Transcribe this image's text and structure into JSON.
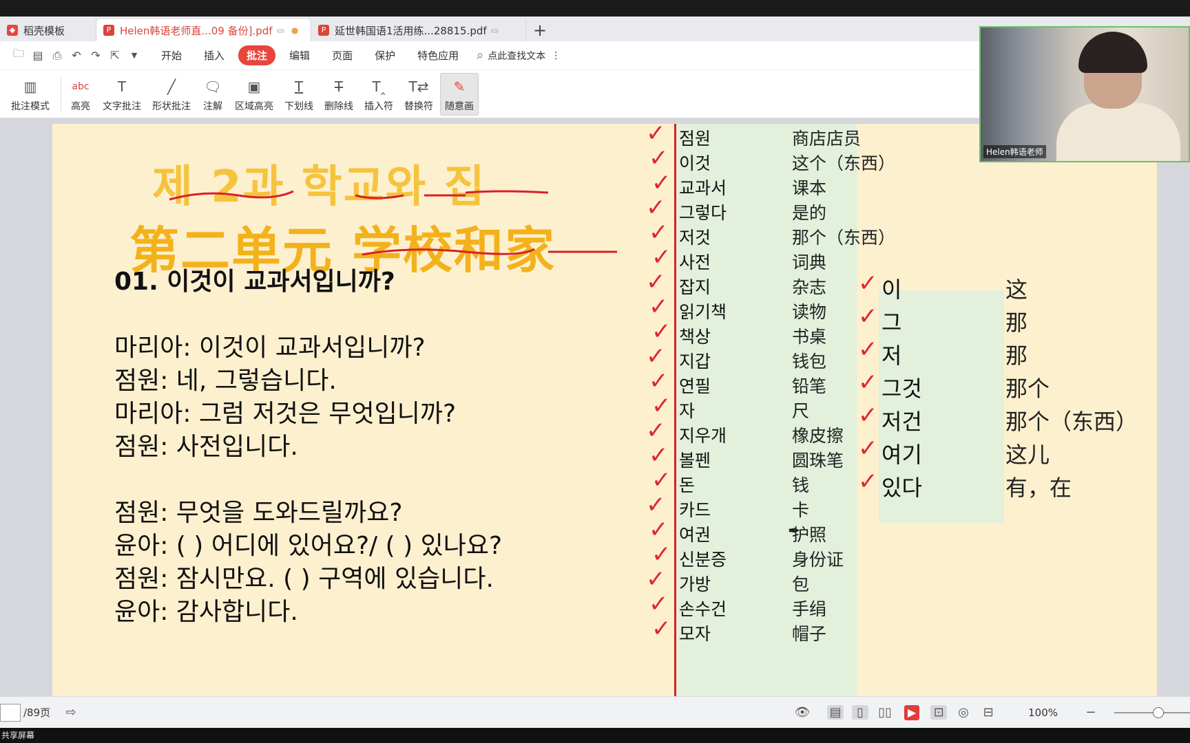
{
  "tabs": [
    {
      "label": "稻壳模板",
      "color": "#e8453c",
      "active": false
    },
    {
      "label": "Helen韩语老师直...09 备份].pdf",
      "color": "#d9453b",
      "active": true
    },
    {
      "label": "延世韩国语1活用练...28815.pdf",
      "color": "#d9453b",
      "active": false
    }
  ],
  "menu": [
    "开始",
    "插入",
    "批注",
    "编辑",
    "页面",
    "保护",
    "特色应用"
  ],
  "menu_active": "批注",
  "search_label": "点此查找文本",
  "ribbon": [
    {
      "label": "批注模式",
      "icon": "annotation-mode-icon"
    },
    {
      "label": "高亮",
      "icon": "highlight-icon"
    },
    {
      "label": "文字批注",
      "icon": "text-annotation-icon"
    },
    {
      "label": "形状批注",
      "icon": "shape-annotation-icon"
    },
    {
      "label": "注解",
      "icon": "note-icon"
    },
    {
      "label": "区域高亮",
      "icon": "area-highlight-icon"
    },
    {
      "label": "下划线",
      "icon": "underline-icon"
    },
    {
      "label": "删除线",
      "icon": "strikethrough-icon"
    },
    {
      "label": "插入符",
      "icon": "insert-caret-icon"
    },
    {
      "label": "替换符",
      "icon": "replace-caret-icon"
    },
    {
      "label": "随意画",
      "icon": "freehand-icon"
    }
  ],
  "document": {
    "title_kr": "제 2과  학교와 집",
    "title_cn": "第二单元  学校和家",
    "lesson": "01. 이것이 교과서입니까?",
    "dialog1": [
      "마리아: 이것이 교과서입니까?",
      "점원: 네, 그렇습니다.",
      "마리아: 그럼 저것은 무엇입니까?",
      "점원: 사전입니다."
    ],
    "dialog2": [
      "점원: 무엇을 도와드릴까요?",
      "윤아: (      ) 어디에 있어요?/ (      ) 있나요?",
      "점원: 잠시만요. (      ) 구역에 있습니다.",
      "윤아:  감사합니다."
    ],
    "vocab": [
      {
        "kr": "점원",
        "cn": "商店店员"
      },
      {
        "kr": "이것",
        "cn": "这个（东西）"
      },
      {
        "kr": "교과서",
        "cn": "课本"
      },
      {
        "kr": "그렇다",
        "cn": "是的"
      },
      {
        "kr": "저것",
        "cn": "那个（东西）"
      },
      {
        "kr": "사전",
        "cn": "词典"
      },
      {
        "kr": "잡지",
        "cn": "杂志"
      },
      {
        "kr": "읽기책",
        "cn": "读物"
      },
      {
        "kr": "책상",
        "cn": "书桌"
      },
      {
        "kr": "지갑",
        "cn": "钱包"
      },
      {
        "kr": "연필",
        "cn": "铅笔"
      },
      {
        "kr": "자",
        "cn": "尺"
      },
      {
        "kr": "지우개",
        "cn": "橡皮擦"
      },
      {
        "kr": "볼펜",
        "cn": "圆珠笔"
      },
      {
        "kr": "돈",
        "cn": "钱"
      },
      {
        "kr": "카드",
        "cn": "卡"
      },
      {
        "kr": "여권",
        "cn": "护照"
      },
      {
        "kr": "신분증",
        "cn": "身份证"
      },
      {
        "kr": "가방",
        "cn": "包"
      },
      {
        "kr": "손수건",
        "cn": "手绢"
      },
      {
        "kr": "모자",
        "cn": "帽子"
      }
    ],
    "demonstratives": [
      {
        "kr": "이",
        "cn": "这"
      },
      {
        "kr": "그",
        "cn": "那"
      },
      {
        "kr": "저",
        "cn": "那"
      },
      {
        "kr": "그것",
        "cn": "那个"
      },
      {
        "kr": "저건",
        "cn": "那个（东西）"
      },
      {
        "kr": "여기",
        "cn": "这儿"
      },
      {
        "kr": "있다",
        "cn": "有，在"
      }
    ]
  },
  "webcam_label": "Helen韩语老师",
  "status": {
    "page_current": "",
    "page_total": "/89页",
    "zoom": "100%"
  },
  "share_label": "共享屏幕",
  "colors": {
    "accent": "#e8453c",
    "page_bg": "#fdf0cf",
    "table_bg": "#e2f0dc",
    "check": "#e0262d"
  }
}
